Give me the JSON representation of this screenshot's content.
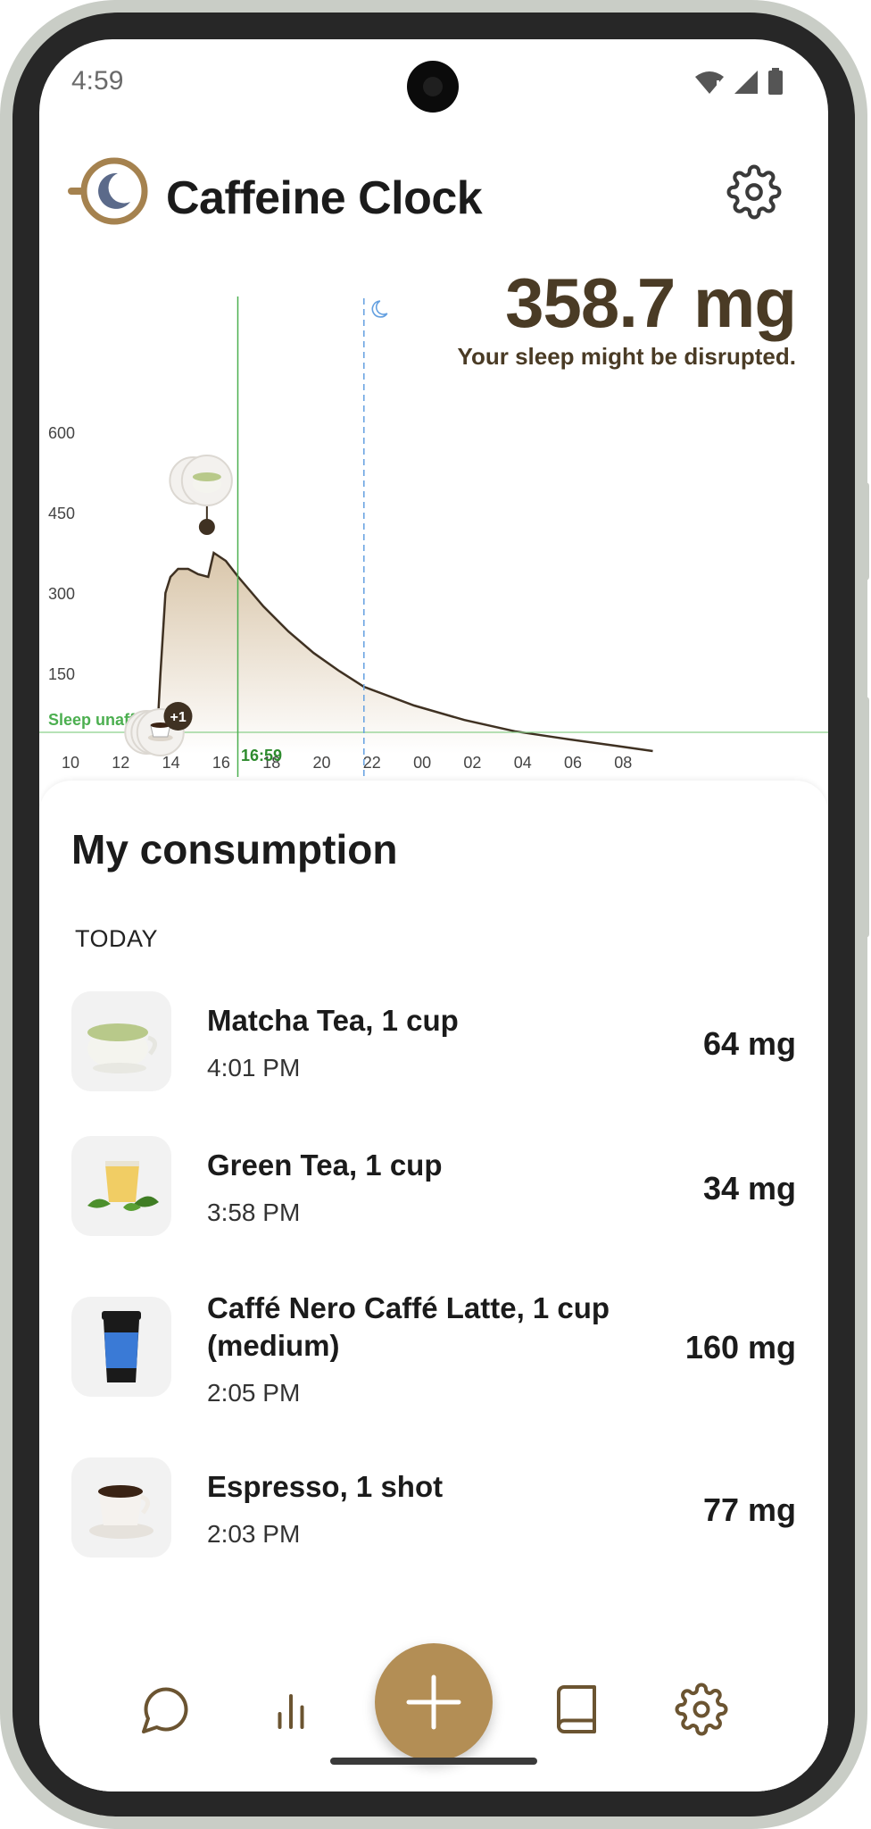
{
  "status_bar": {
    "time": "4:59"
  },
  "header": {
    "title": "Caffeine Clock"
  },
  "summary": {
    "amount": "358.7 mg",
    "message": "Your sleep might be disrupted."
  },
  "chart_data": {
    "type": "area",
    "x_ticks": [
      "10",
      "12",
      "14",
      "16",
      "18",
      "20",
      "22",
      "00",
      "02",
      "04",
      "06",
      "08"
    ],
    "y_ticks": [
      "600",
      "450",
      "300",
      "150"
    ],
    "ylim": [
      0,
      600
    ],
    "threshold_label": "Sleep unaffected",
    "now_label": "16:59",
    "badge_label": "+1",
    "series": [
      {
        "x": [
          13.75,
          13.9,
          14.1,
          14.3,
          14.6,
          15.0,
          15.4,
          15.8,
          16.02,
          16.5,
          17.0,
          18.0,
          19.0,
          20.0,
          21.0,
          22.0,
          24.0,
          26.0,
          28.0,
          30.0,
          32.0,
          33.5
        ],
        "y": [
          20,
          150,
          300,
          330,
          345,
          345,
          335,
          330,
          375,
          360,
          330,
          275,
          228,
          188,
          155,
          125,
          90,
          63,
          42,
          28,
          15,
          5
        ]
      }
    ],
    "colors": {
      "curve": "#3f3122",
      "fill_top": "#d9c6aa",
      "fill_bottom": "#ffffff",
      "now_line": "#4caf50",
      "sleep_line": "#64a0e0",
      "threshold_line": "#8bd08b"
    }
  },
  "consumption": {
    "title": "My consumption",
    "section": "TODAY",
    "items": [
      {
        "name": "Matcha Tea, 1 cup",
        "time": "4:01 PM",
        "amount": "64 mg",
        "icon": "matcha-cup-icon"
      },
      {
        "name": "Green Tea, 1 cup",
        "time": "3:58 PM",
        "amount": "34 mg",
        "icon": "green-tea-icon"
      },
      {
        "name": "Caffé Nero Caffé Latte, 1 cup (medium)",
        "time": "2:05 PM",
        "amount": "160 mg",
        "icon": "takeaway-cup-icon"
      },
      {
        "name": "Espresso, 1 shot",
        "time": "2:03 PM",
        "amount": "77 mg",
        "icon": "espresso-cup-icon"
      }
    ]
  },
  "nav": {
    "items": [
      "chat-icon",
      "stats-icon",
      "add-icon",
      "book-icon",
      "settings-icon"
    ],
    "accent": "#b38e55",
    "icon_color": "#6b5431"
  }
}
